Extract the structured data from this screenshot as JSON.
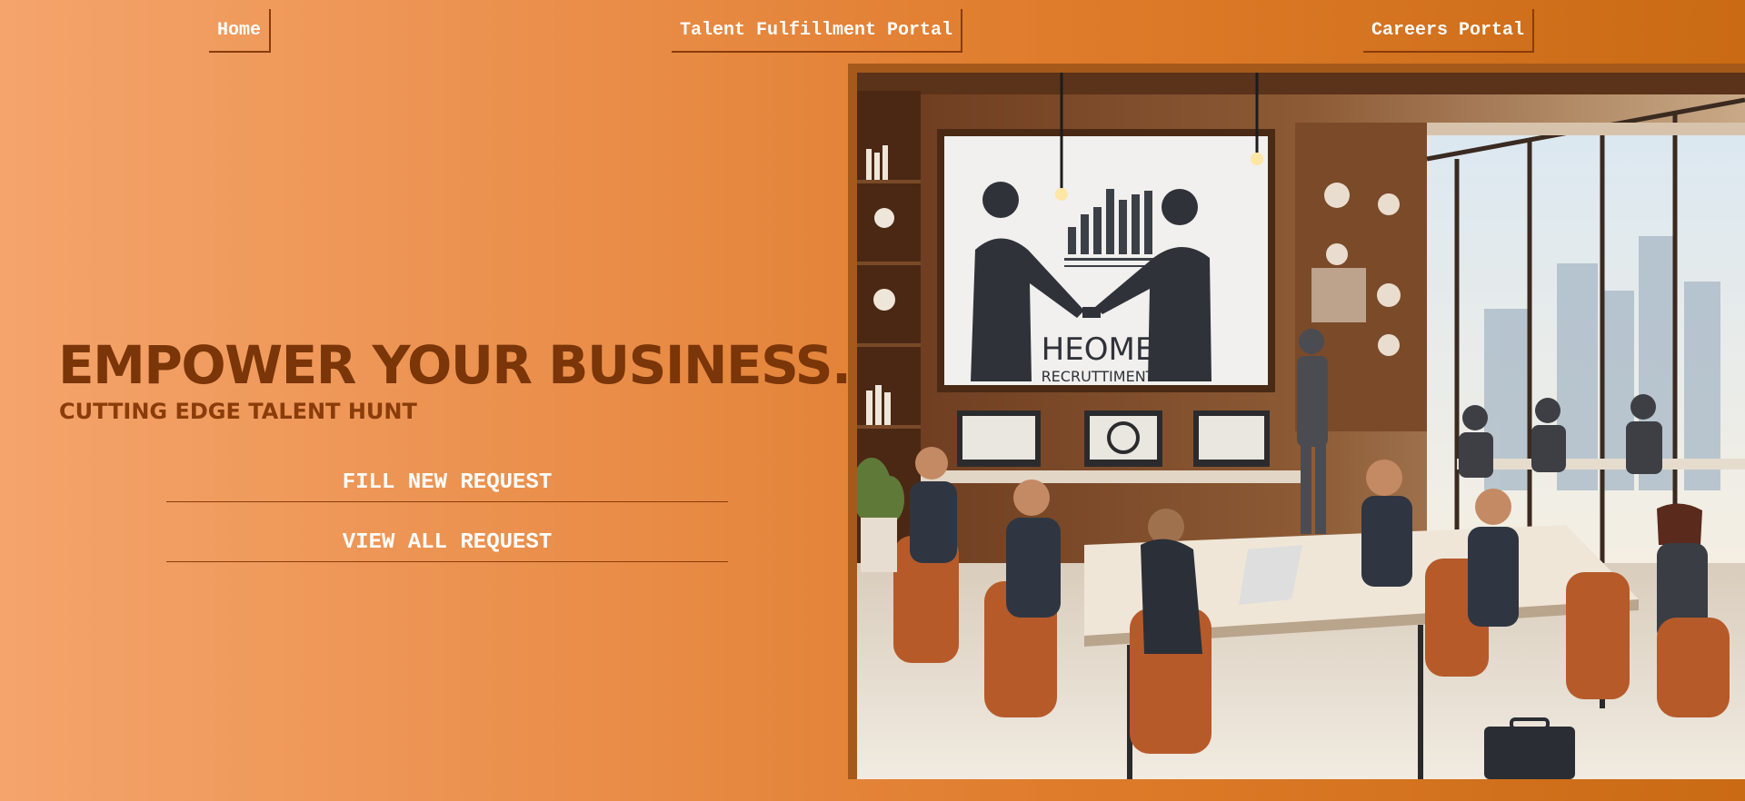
{
  "nav": {
    "home": "Home",
    "talent_portal": "Talent Fulfillment Portal",
    "careers_portal": "Careers Portal"
  },
  "hero": {
    "title": "EMPOWER YOUR BUSINESS.",
    "subtitle": "CUTTING EDGE TALENT HUNT"
  },
  "actions": {
    "fill_new_request": "FILL NEW REQUEST",
    "view_all_request": "VIEW ALL REQUEST"
  },
  "illustration": {
    "screen_text_line1": "HEOME",
    "screen_text_line2": "RECRUTTIMENT"
  },
  "colors": {
    "gradient_start": "#f5a46c",
    "gradient_end": "#c96a14",
    "heading": "#7a3508",
    "button_text": "#ffffff"
  }
}
